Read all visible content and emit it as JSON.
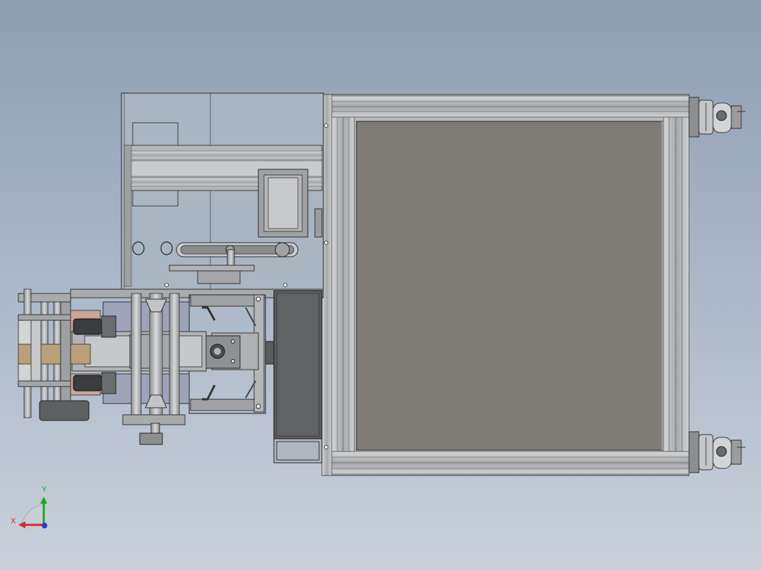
{
  "viewport": {
    "background_top": "#8e9db2",
    "background_bottom": "#c9d0da"
  },
  "model": {
    "frame_color": "#9a9c9e",
    "panel_color": "#7e7a76",
    "glass_color": "#aab5c2",
    "dark_part_color": "#5a5c60",
    "accent_brown": "#b8a07a",
    "accent_pink": "#c9a59a"
  },
  "triad": {
    "x_label": "X",
    "y_label": "Y",
    "x_color": "#d42a2a",
    "y_color": "#1fa52a",
    "z_color": "#2a3ad4"
  }
}
